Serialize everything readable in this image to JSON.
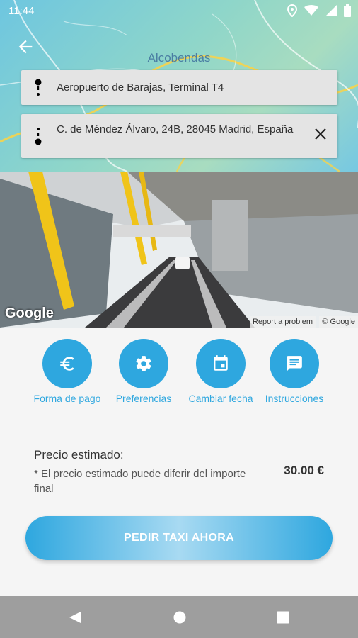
{
  "status_bar": {
    "time": "11:44"
  },
  "map": {
    "city_label": "Alcobendas"
  },
  "route": {
    "origin": "Aeropuerto de Barajas, Terminal T4",
    "destination": "C. de Méndez Álvaro, 24B, 28045 Madrid, España"
  },
  "street_view": {
    "google_logo": "Google",
    "report_problem": "Report a problem",
    "copyright": "© Google"
  },
  "actions": [
    {
      "label": "Forma de pago",
      "icon": "euro-icon"
    },
    {
      "label": "Preferencias",
      "icon": "gear-icon"
    },
    {
      "label": "Cambiar fecha",
      "icon": "calendar-icon"
    },
    {
      "label": "Instrucciones",
      "icon": "message-icon"
    }
  ],
  "price": {
    "title": "Precio estimado:",
    "note": "* El precio estimado puede diferir del importe final",
    "value": "30.00 €"
  },
  "cta": {
    "label": "PEDIR TAXI AHORA"
  },
  "colors": {
    "accent": "#2ea7df",
    "navbar": "#9e9e9e",
    "field_bg": "#e4e4e4"
  }
}
